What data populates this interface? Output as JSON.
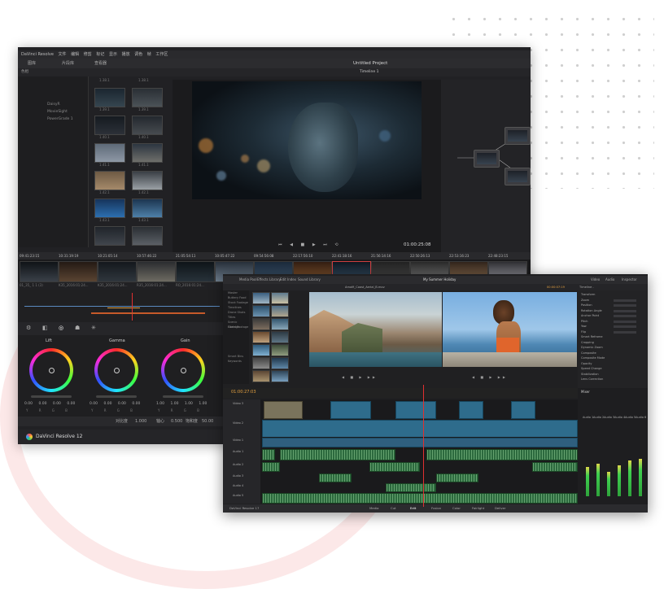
{
  "back": {
    "menu": [
      "DaVinci Resolve",
      "文件",
      "编辑",
      "修剪",
      "标记",
      "显示",
      "播放",
      "调色",
      "帧",
      "工作区"
    ],
    "toolbar": {
      "media": "图库",
      "clips": "片段库",
      "lut": "LUT",
      "project": "Untitled Project",
      "timeline": "Timeline 1",
      "view": "查看器"
    },
    "sidebar": [
      "DaisyR",
      "MovieSight",
      "PowerGrade 1"
    ],
    "thumb_labels": [
      "1.38.1",
      "1.38.1",
      "1.39.1",
      "1.39.1",
      "1.40.1",
      "1.40.1",
      "1.41.1",
      "1.41.1",
      "1.42.1",
      "1.42.1",
      "1.43.1",
      "1.43.1"
    ],
    "viewer_time": "01:00:25:08",
    "strip_times": [
      "09:41:23:15",
      "10:31:19:19",
      "10:21:05:14",
      "10:57:46:22",
      "21:05:54:11",
      "10:05:47:22",
      "09:54:56:08",
      "22:17:56:10",
      "22:41:18:16",
      "21:56:14:16",
      "22:50:26:13",
      "22:53:16:23",
      "22:48:23:15"
    ],
    "strip_labels": [
      "01_35_ 1 1 (3)",
      "K35_2016:01:24...",
      "K35_2016:01:24...",
      "R35_2016:01:24...",
      "RO_2016:01:24..."
    ],
    "wheels": [
      {
        "title": "Lift",
        "values": "0.00 0.00 0.00 0.00"
      },
      {
        "title": "Gamma",
        "values": "0.00 0.00 0.00 0.00"
      },
      {
        "title": "Gain",
        "values": "1.00 1.00 1.00 1.00"
      }
    ],
    "wheel_channel_labels": "Y R G B",
    "bottom": {
      "contrast_label": "对比度",
      "contrast_val": "1.000",
      "pivot_label": "轴心",
      "pivot_val": "0.500",
      "sat_label": "饱和度",
      "sat_val": "50.00"
    },
    "brand": "DaVinci Resolve 12",
    "color_mode": "色相"
  },
  "front": {
    "tabs": [
      "Media Pool",
      "Effects Library",
      "Edit Index",
      "Sound Library"
    ],
    "center_title": "My Summer Holiday",
    "clip_title": "Amalfi_Coast_Aerial_B.mov",
    "viewer_tc": "00:00:07:19",
    "inspector_title": "Timeline - take_tool_to_the_bank_bright.PRORES422.mov",
    "inspector_tabs": [
      "Video",
      "Audio",
      "Inspector"
    ],
    "inspector_rows": [
      "Transform",
      "Zoom",
      "Position",
      "Rotation Angle",
      "Anchor Point",
      "Pitch",
      "Yaw",
      "Flip",
      "Smart Reframe",
      "Cropping",
      "Dynamic Zoom",
      "Composite",
      "Composite Mode",
      "Opacity",
      "Speed Change",
      "Stabilization",
      "Lens Correction"
    ],
    "sidebar": [
      "Master",
      "Buttery Food",
      "Stock Footage",
      "Timelines",
      "Drone Shots",
      "Titles",
      "Scenic Footage",
      "Client Footage",
      "Smart Bins",
      "Keywords"
    ],
    "timecode": "01:00:27:03",
    "tracks": [
      "Video 3",
      "Video 2",
      "Video 1",
      "Audio 1",
      "Audio 2",
      "Audio 3",
      "Audio 4",
      "Audio 5"
    ],
    "mixer_title": "Mixer",
    "mixer_channels": [
      "Audio 1",
      "Audio 2",
      "Audio 3",
      "Audio 4",
      "Audio 5",
      "Audio 6"
    ],
    "brand": "DaVinci Resolve 17",
    "pages": [
      "Media",
      "Cut",
      "Edit",
      "Fusion",
      "Color",
      "Fairlight",
      "Deliver"
    ]
  }
}
